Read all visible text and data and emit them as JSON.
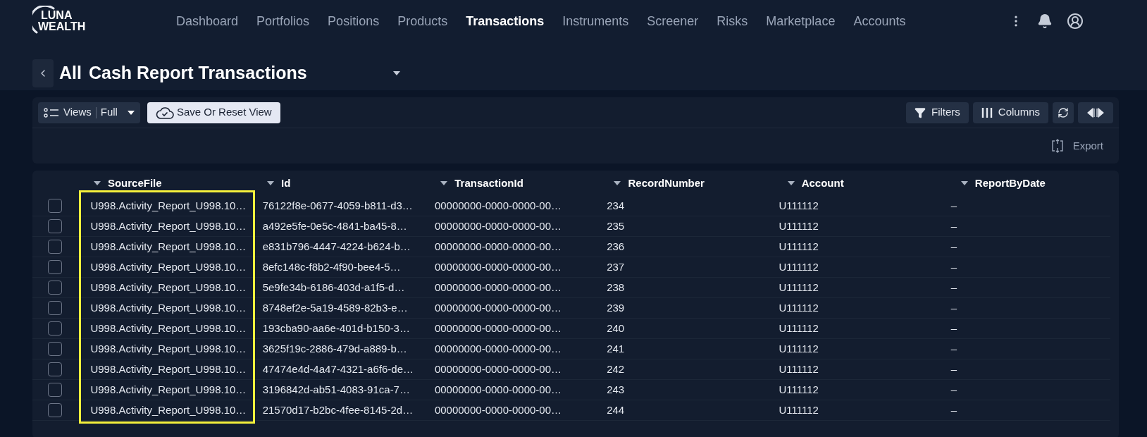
{
  "logo": {
    "line1": "LUNA",
    "line2": "WEALTH"
  },
  "nav": [
    {
      "label": "Dashboard",
      "selected": false
    },
    {
      "label": "Portfolios",
      "selected": false
    },
    {
      "label": "Positions",
      "selected": false
    },
    {
      "label": "Products",
      "selected": false
    },
    {
      "label": "Transactions",
      "selected": true
    },
    {
      "label": "Instruments",
      "selected": false
    },
    {
      "label": "Screener",
      "selected": false
    },
    {
      "label": "Risks",
      "selected": false
    },
    {
      "label": "Marketplace",
      "selected": false
    },
    {
      "label": "Accounts",
      "selected": false
    }
  ],
  "title": {
    "prefix": "All",
    "name": "Cash Report Transactions"
  },
  "toolbar": {
    "views_label": "Views",
    "views_value": "Full",
    "save_button": "Save Or Reset View",
    "filters": "Filters",
    "columns": "Columns",
    "export": "Export"
  },
  "table": {
    "columns": [
      {
        "label": "SourceFile",
        "highlighted": true
      },
      {
        "label": "Id",
        "highlighted": false
      },
      {
        "label": "TransactionId",
        "highlighted": false
      },
      {
        "label": "RecordNumber",
        "highlighted": false
      },
      {
        "label": "Account",
        "highlighted": false
      },
      {
        "label": "ReportByDate",
        "highlighted": false
      }
    ],
    "rows": [
      {
        "checked": false,
        "cells": [
          "U998.Activity_Report_U998.10…",
          "76122f8e-0677-4059-b811-d3…",
          "00000000-0000-0000-00…",
          "234",
          "U111112",
          "–"
        ]
      },
      {
        "checked": false,
        "cells": [
          "U998.Activity_Report_U998.10…",
          "a492e5fe-0e5c-4841-ba45-8…",
          "00000000-0000-0000-00…",
          "235",
          "U111112",
          "–"
        ]
      },
      {
        "checked": false,
        "cells": [
          "U998.Activity_Report_U998.10…",
          "e831b796-4447-4224-b624-b…",
          "00000000-0000-0000-00…",
          "236",
          "U111112",
          "–"
        ]
      },
      {
        "checked": false,
        "cells": [
          "U998.Activity_Report_U998.10…",
          "8efc148c-f8b2-4f90-bee4-5…",
          "00000000-0000-0000-00…",
          "237",
          "U111112",
          "–"
        ]
      },
      {
        "checked": false,
        "cells": [
          "U998.Activity_Report_U998.10…",
          "5e9fe34b-6186-403d-a1f5-d…",
          "00000000-0000-0000-00…",
          "238",
          "U111112",
          "–"
        ]
      },
      {
        "checked": false,
        "cells": [
          "U998.Activity_Report_U998.10…",
          "8748ef2e-5a19-4589-82b3-e…",
          "00000000-0000-0000-00…",
          "239",
          "U111112",
          "–"
        ]
      },
      {
        "checked": false,
        "cells": [
          "U998.Activity_Report_U998.10…",
          "193cba90-aa6e-401d-b150-3…",
          "00000000-0000-0000-00…",
          "240",
          "U111112",
          "–"
        ]
      },
      {
        "checked": false,
        "cells": [
          "U998.Activity_Report_U998.10…",
          "3625f19c-2886-479d-a889-b…",
          "00000000-0000-0000-00…",
          "241",
          "U111112",
          "–"
        ]
      },
      {
        "checked": false,
        "cells": [
          "U998.Activity_Report_U998.10…",
          "47474e4d-4a47-4321-a6f6-de…",
          "00000000-0000-0000-00…",
          "242",
          "U111112",
          "–"
        ]
      },
      {
        "checked": false,
        "cells": [
          "U998.Activity_Report_U998.10…",
          "3196842d-ab51-4083-91ca-7…",
          "00000000-0000-0000-00…",
          "243",
          "U111112",
          "–"
        ]
      },
      {
        "checked": false,
        "cells": [
          "U998.Activity_Report_U998.10…",
          "21570d17-b2bc-4fee-8145-2d…",
          "00000000-0000-0000-00…",
          "244",
          "U111112",
          "–"
        ]
      }
    ]
  }
}
